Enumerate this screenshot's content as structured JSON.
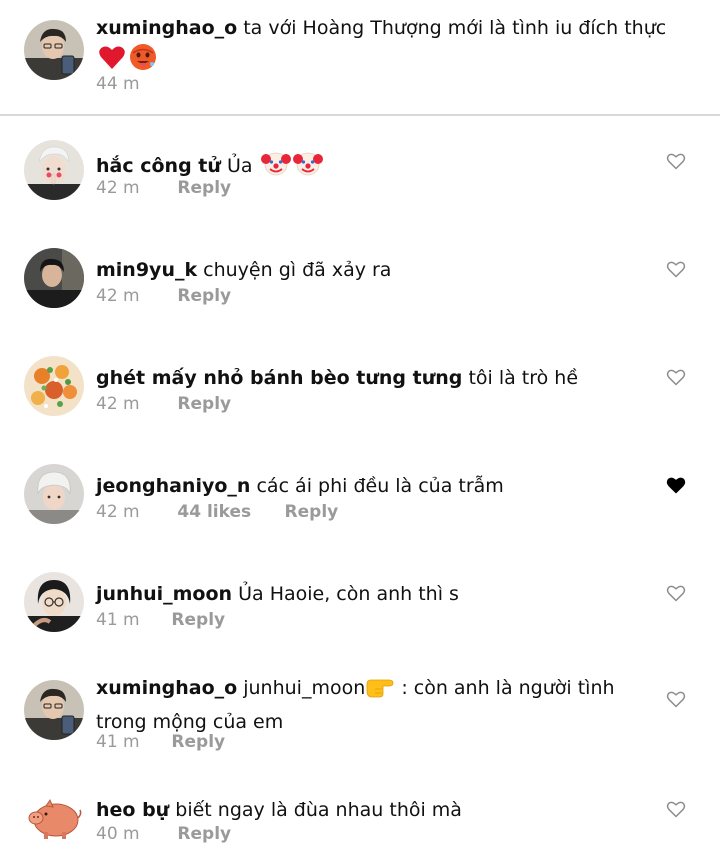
{
  "caption": {
    "username": "xuminghao_o",
    "text": "ta với Hoàng Thượng mới là tình iu đích thực",
    "emojis": [
      "red-heart",
      "hot-face"
    ],
    "time": "44 m"
  },
  "comments": [
    {
      "username": "hắc công tử",
      "text": "Ủa",
      "emojis": [
        "clown-face",
        "clown-face"
      ],
      "time": "42 m",
      "likes": "",
      "reply": "Reply",
      "liked": false,
      "avatar": "man-white-hair"
    },
    {
      "username": "min9yu_k",
      "text": "chuyện gì đã xảy ra",
      "time": "42 m",
      "likes": "",
      "reply": "Reply",
      "liked": false,
      "avatar": "man-dark"
    },
    {
      "username": "ghét mấy nhỏ bánh bèo tưng tưng",
      "text": "tôi là trò hề",
      "time": "42 m",
      "likes": "",
      "reply": "Reply",
      "liked": false,
      "avatar": "food-photo"
    },
    {
      "username": "jeonghaniyo_n",
      "text": "các ái phi đều là của trẫm",
      "time": "42 m",
      "likes": "44 likes",
      "reply": "Reply",
      "liked": true,
      "avatar": "man-beanie"
    },
    {
      "username": "junhui_moon",
      "text": "Ủa Haoie,  còn anh thì s",
      "time": "41 m",
      "likes": "",
      "reply": "Reply",
      "liked": false,
      "avatar": "man-glasses"
    },
    {
      "username": "xuminghao_o",
      "mention": "junhui_moon",
      "mention_emoji": "backhand-index-pointing-right",
      "text": ": còn anh là người tình trong mộng của em",
      "time": "41 m",
      "likes": "",
      "reply": "Reply",
      "liked": false,
      "avatar": "man-phone"
    },
    {
      "username": "heo bự",
      "text": "biết ngay là đùa nhau thôi mà",
      "time": "40 m",
      "likes": "",
      "reply": "Reply",
      "liked": false,
      "avatar": "pig-cartoon"
    }
  ],
  "colors": {
    "meta_grey": "#9a9a9a",
    "divider": "#d9d9d9",
    "heart_outline": "#8e8e8e",
    "heart_filled": "#000000"
  }
}
